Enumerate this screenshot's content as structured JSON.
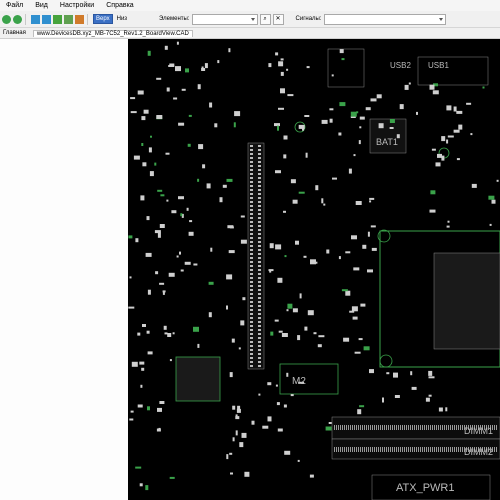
{
  "menu": [
    "Файл",
    "Вид",
    "Настройки",
    "Справка"
  ],
  "toolbar": {
    "side_top": "Верх",
    "side_bottom": "Низ",
    "elements_label": "Элементы:",
    "elements_value": "",
    "signals_label": "Сигналы:",
    "signals_value": ""
  },
  "tabs": {
    "home": "Главная",
    "file": "www.DevicesDB.xyz_MB-7C52_Rev1.2_BoardView.CAD"
  },
  "board": {
    "labels": {
      "bat": "BAT1",
      "usb_a": "USB2",
      "usb_b": "USB1",
      "m2": "M2",
      "atx": "ATX_PWR1",
      "dimm_a": "DIMM1",
      "dimm_b": "DIMM2"
    },
    "colors": {
      "background": "#000000",
      "outline": "#3aa24a",
      "component": "#cfcfcf"
    }
  }
}
